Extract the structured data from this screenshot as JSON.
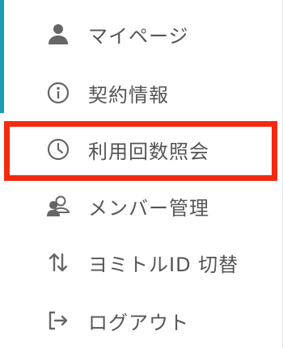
{
  "menu": {
    "items": [
      {
        "label": "マイページ",
        "icon": "user-icon"
      },
      {
        "label": "契約情報",
        "icon": "info-icon"
      },
      {
        "label": "利用回数照会",
        "icon": "clock-icon",
        "highlighted": true
      },
      {
        "label": "メンバー管理",
        "icon": "members-icon"
      },
      {
        "label": "ヨミトルID 切替",
        "icon": "switch-arrows-icon"
      },
      {
        "label": "ログアウト",
        "icon": "logout-icon"
      }
    ]
  },
  "colors": {
    "highlight_border": "#f42a0f",
    "left_accent": "#1e9bb7",
    "text": "#555555",
    "icon": "#666666"
  }
}
